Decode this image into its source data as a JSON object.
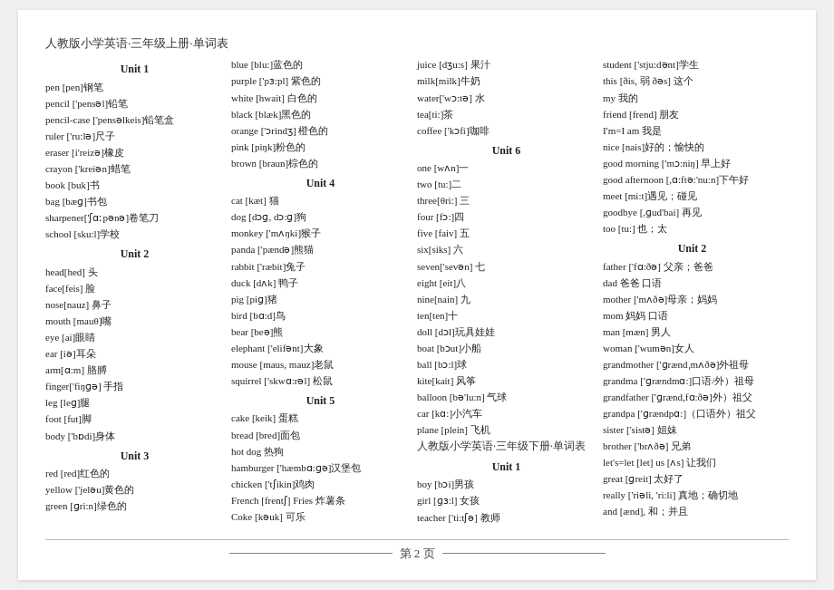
{
  "pageTitle": "人教版小学英语·三年级上册·单词表",
  "columns": [
    {
      "id": "col1",
      "entries": [
        {
          "type": "unit",
          "text": "Unit 1"
        },
        {
          "type": "word",
          "text": "pen [pen]钢笔"
        },
        {
          "type": "word",
          "text": "pencil ['pensəl]铅笔"
        },
        {
          "type": "word",
          "text": "pencil-case ['pensəlkeis]铅笔盒"
        },
        {
          "type": "word",
          "text": "ruler ['ru:lə]尺子"
        },
        {
          "type": "word",
          "text": "eraser [i'reizə]橡皮"
        },
        {
          "type": "word",
          "text": "crayon ['kreiən]蜡笔"
        },
        {
          "type": "word",
          "text": "book [buk]书"
        },
        {
          "type": "word",
          "text": "bag [bæɡ]书包"
        },
        {
          "type": "word",
          "text": "sharpener['ʃɑːpənə]卷笔刀"
        },
        {
          "type": "word",
          "text": "school [sku:l]学校"
        },
        {
          "type": "unit",
          "text": "Unit 2"
        },
        {
          "type": "word",
          "text": "head[hed]  头"
        },
        {
          "type": "word",
          "text": "face[feis] 脸"
        },
        {
          "type": "word",
          "text": "nose[nauz] 鼻子"
        },
        {
          "type": "word",
          "text": "mouth [mauθ]嘴"
        },
        {
          "type": "word",
          "text": "eye [ai]眼睛"
        },
        {
          "type": "word",
          "text": "ear [iə]耳朵"
        },
        {
          "type": "word",
          "text": "arm[ɑ:m]  胳膊"
        },
        {
          "type": "word",
          "text": "finger['fiŋɡə] 手指"
        },
        {
          "type": "word",
          "text": "leg [leɡ]腿"
        },
        {
          "type": "word",
          "text": "foot [fut]脚"
        },
        {
          "type": "word",
          "text": "body ['bɒdi]身体"
        },
        {
          "type": "unit",
          "text": "Unit 3"
        },
        {
          "type": "word",
          "text": "red [red]红色的"
        },
        {
          "type": "word",
          "text": "yellow ['jeləu]黄色的"
        },
        {
          "type": "word",
          "text": "green [ɡri:n]绿色的"
        }
      ]
    },
    {
      "id": "col2",
      "entries": [
        {
          "type": "word",
          "text": "blue [blu:]蓝色的"
        },
        {
          "type": "word",
          "text": "purple ['pɜ:pl] 紫色的"
        },
        {
          "type": "word",
          "text": "white [hwait] 白色的"
        },
        {
          "type": "word",
          "text": "black [blæk]黑色的"
        },
        {
          "type": "word",
          "text": "orange ['ɔrindʒ] 橙色的"
        },
        {
          "type": "word",
          "text": "pink [piŋk]粉色的"
        },
        {
          "type": "word",
          "text": "brown [braun]棕色的"
        },
        {
          "type": "unit",
          "text": "Unit 4"
        },
        {
          "type": "word",
          "text": "cat [kæt] 猫"
        },
        {
          "type": "word",
          "text": "dog [dɔɡ, dɔ:ɡ]狗"
        },
        {
          "type": "word",
          "text": "monkey ['mʌŋki]猴子"
        },
        {
          "type": "word",
          "text": "panda ['pændə]熊猫"
        },
        {
          "type": "word",
          "text": "rabbit ['ræbit]兔子"
        },
        {
          "type": "word",
          "text": "duck [dʌk] 鸭子"
        },
        {
          "type": "word",
          "text": "pig [piɡ]猪"
        },
        {
          "type": "word",
          "text": "bird [bɑ:d]鸟"
        },
        {
          "type": "word",
          "text": "bear [beə]熊"
        },
        {
          "type": "word",
          "text": "elephant ['elifənt]大象"
        },
        {
          "type": "word",
          "text": "mouse [maus, mauz]老鼠"
        },
        {
          "type": "word",
          "text": "squirrel ['skwɑ:rəl] 松鼠"
        },
        {
          "type": "unit",
          "text": "Unit 5"
        },
        {
          "type": "word",
          "text": "cake [keik] 蛋糕"
        },
        {
          "type": "word",
          "text": "bread [bred]面包"
        },
        {
          "type": "word",
          "text": "hot dog 热狗"
        },
        {
          "type": "word",
          "text": "hamburger ['hæmbɑ:ɡə]汉堡包"
        },
        {
          "type": "word",
          "text": "chicken ['tʃikin]鸡肉"
        },
        {
          "type": "word",
          "text": "French [frentʃ]  Fries 炸薯条"
        },
        {
          "type": "word",
          "text": "Coke [kəuk] 可乐"
        }
      ]
    },
    {
      "id": "col3",
      "entries": [
        {
          "type": "word",
          "text": "juice [dʒu:s] 果汁"
        },
        {
          "type": "word",
          "text": "milk[milk]牛奶"
        },
        {
          "type": "word",
          "text": "water['wɔ:tə] 水"
        },
        {
          "type": "word",
          "text": "tea[ti:]茶"
        },
        {
          "type": "word",
          "text": "coffee ['kɔfi]咖啡"
        },
        {
          "type": "unit",
          "text": "Unit 6"
        },
        {
          "type": "word",
          "text": "one [wʌn]一"
        },
        {
          "type": "word",
          "text": "two [tu:]二"
        },
        {
          "type": "word",
          "text": "three[θri:] 三"
        },
        {
          "type": "word",
          "text": "four [fɔ:]四"
        },
        {
          "type": "word",
          "text": "five [faiv]  五"
        },
        {
          "type": "word",
          "text": "six[siks] 六"
        },
        {
          "type": "word",
          "text": "seven['sevən] 七"
        },
        {
          "type": "word",
          "text": "eight [eit]八"
        },
        {
          "type": "word",
          "text": "nine[nain] 九"
        },
        {
          "type": "word",
          "text": "ten[ten]十"
        },
        {
          "type": "word",
          "text": "doll [dɔl]玩具娃娃"
        },
        {
          "type": "word",
          "text": "boat [bɔut]小船"
        },
        {
          "type": "word",
          "text": "ball [bɔ:l]球"
        },
        {
          "type": "word",
          "text": "kite[kait]  风筝"
        },
        {
          "type": "word",
          "text": "balloon [bə'lu:n] 气球"
        },
        {
          "type": "word",
          "text": "car [kɑ:]小汽车"
        },
        {
          "type": "word",
          "text": "plane [plein] 飞机"
        },
        {
          "type": "subtitle",
          "text": "人教版小学英语·三年级下册·单词表"
        },
        {
          "type": "unit",
          "text": "Unit 1"
        },
        {
          "type": "word",
          "text": "boy [bɔi]男孩"
        },
        {
          "type": "word",
          "text": "girl [ɡɜ:l] 女孩"
        },
        {
          "type": "word",
          "text": "teacher ['ti:tʃə] 教师"
        }
      ]
    },
    {
      "id": "col4",
      "entries": [
        {
          "type": "word",
          "text": "student ['stju:dənt]学生"
        },
        {
          "type": "word",
          "text": "this [ðis, 弱 ðəs] 这个"
        },
        {
          "type": "word",
          "text": "my 我的"
        },
        {
          "type": "word",
          "text": "friend [frend] 朋友"
        },
        {
          "type": "word",
          "text": "I'm=I am 我是"
        },
        {
          "type": "word",
          "text": "nice [nais]好的；愉快的"
        },
        {
          "type": "word",
          "text": "good morning ['mɔ:niŋ] 早上好"
        },
        {
          "type": "word",
          "text": "good afternoon [,ɑ:ftə:'nu:n]下午好"
        },
        {
          "type": "word",
          "text": "meet [mi:t]遇见；碰见"
        },
        {
          "type": "word",
          "text": "goodbye [,ɡud'bai] 再见"
        },
        {
          "type": "word",
          "text": "too [tu:] 也；太"
        },
        {
          "type": "unit",
          "text": "Unit 2"
        },
        {
          "type": "word",
          "text": "father ['fɑ:ðə] 父亲；爸爸"
        },
        {
          "type": "word",
          "text": "dad 爸爸 口语"
        },
        {
          "type": "word",
          "text": "mother ['mʌðə]母亲；妈妈"
        },
        {
          "type": "word",
          "text": "mom 妈妈 口语"
        },
        {
          "type": "word",
          "text": "man [mæn] 男人"
        },
        {
          "type": "word",
          "text": "woman ['wumən]女人"
        },
        {
          "type": "word",
          "text": "grandmother ['ɡrændˌmʌðə]外祖母"
        },
        {
          "type": "word",
          "text": "grandma ['ɡrændmɑ:]口语/外）祖母"
        },
        {
          "type": "word",
          "text": "grandfather ['ɡrænd,fɑ:ðə]外）祖父"
        },
        {
          "type": "word",
          "text": "grandpa ['ɡrændpɑ:]（口语外）祖父"
        },
        {
          "type": "word",
          "text": "sister ['sistə] 姐妹"
        },
        {
          "type": "word",
          "text": "brother ['brʌðə] 兄弟"
        },
        {
          "type": "word",
          "text": "let's=let [let]  us [ʌs] 让我们"
        },
        {
          "type": "word",
          "text": "great [ɡreit] 太好了"
        },
        {
          "type": "word",
          "text": "really ['riəli, 'ri:li] 真地；确切地"
        },
        {
          "type": "word",
          "text": "and [ænd], 和；并且"
        }
      ]
    }
  ],
  "footer": {
    "text": "第 2 页"
  }
}
